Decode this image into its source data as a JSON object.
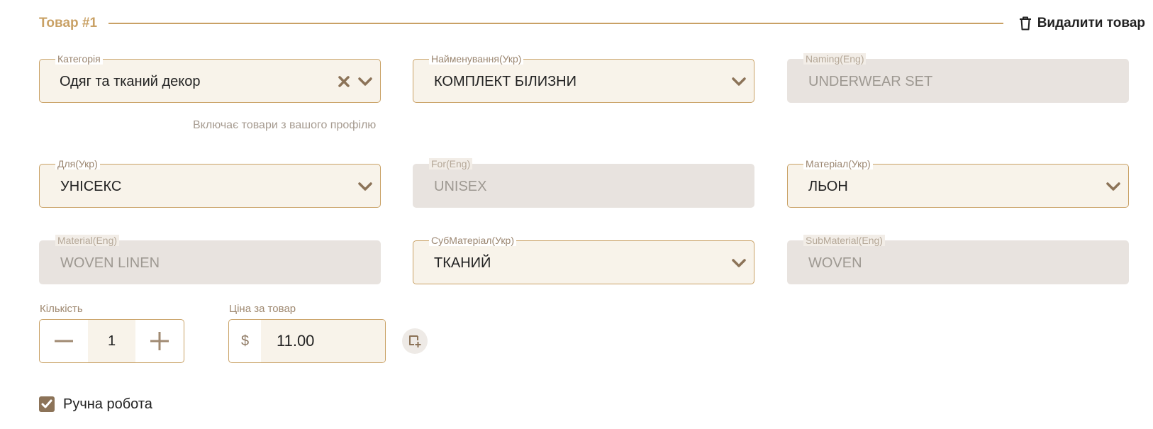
{
  "product": {
    "title": "Товар #1",
    "delete_label": "Видалити товар"
  },
  "fields": {
    "category": {
      "label": "Категорія",
      "value": "Одяг та тканий декор"
    },
    "name_ukr": {
      "label": "Найменування(Укр)",
      "value": "КОМПЛЕКТ БІЛИЗНИ"
    },
    "name_eng": {
      "label": "Naming(Eng)",
      "value": "UNDERWEAR SET"
    },
    "for_ukr": {
      "label": "Для(Укр)",
      "value": "УНІСЕКС"
    },
    "for_eng": {
      "label": "For(Eng)",
      "value": "UNISEX"
    },
    "material_ukr": {
      "label": "Матеріал(Укр)",
      "value": "ЛЬОН"
    },
    "material_eng": {
      "label": "Material(Eng)",
      "value": "WOVEN LINEN"
    },
    "submaterial_ukr": {
      "label": "СубМатеріал(Укр)",
      "value": "ТКАНИЙ"
    },
    "submaterial_eng": {
      "label": "SubMaterial(Eng)",
      "value": "WOVEN"
    }
  },
  "category_hint": "Включає товари з вашого профілю",
  "quantity": {
    "label": "Кількість",
    "value": "1"
  },
  "price": {
    "label": "Ціна за товар",
    "currency": "$",
    "value": "11.00"
  },
  "handmade": {
    "label": "Ручна робота",
    "checked": true
  },
  "icons": {
    "delete": "trash-icon",
    "clear": "close-icon",
    "dropdown": "chevron-down-icon",
    "decrement": "minus-icon",
    "increment": "plus-icon",
    "copy": "copy-add-icon",
    "check": "check-icon"
  },
  "colors": {
    "accent": "#c9a165",
    "field_bg": "#f8f3ea",
    "disabled_bg": "#e8e3df",
    "checkbox": "#8c7358"
  }
}
